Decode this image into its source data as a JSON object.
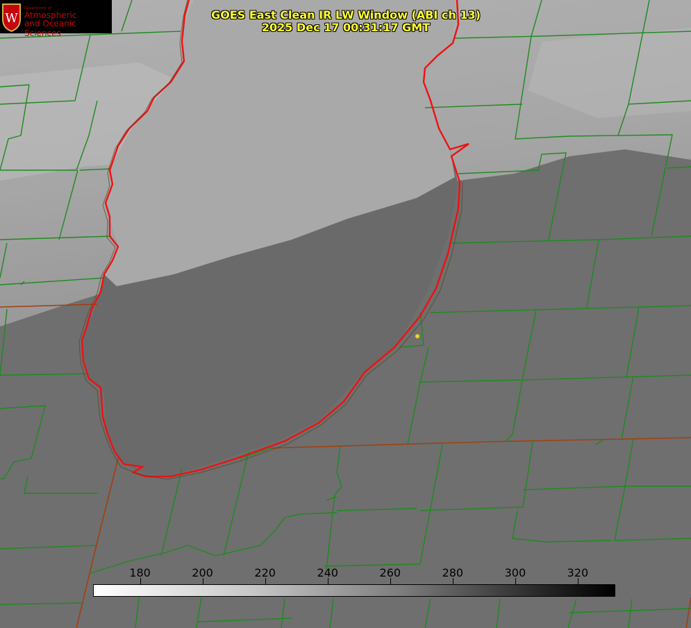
{
  "title": {
    "line1": "GOES East Clean IR LW Window (ABI ch 13)",
    "line2": "2025 Dec 17 00:31:17 GMT"
  },
  "logo": {
    "department": "Department of",
    "line1": "Atmospheric",
    "line2": "and Oceanic Sciences",
    "seal_letter": "W",
    "color": "#c5050c"
  },
  "colorbar": {
    "ticks": [
      "180",
      "200",
      "220",
      "240",
      "260",
      "280",
      "300",
      "320"
    ],
    "range": [
      165,
      332
    ],
    "colormap": "white-to-black grayscale"
  },
  "map_colors": {
    "county_lines": "#1e8a1e",
    "state_lines": "#a04010",
    "lake_outline": "#ee1111",
    "marker": "#e8d820"
  }
}
